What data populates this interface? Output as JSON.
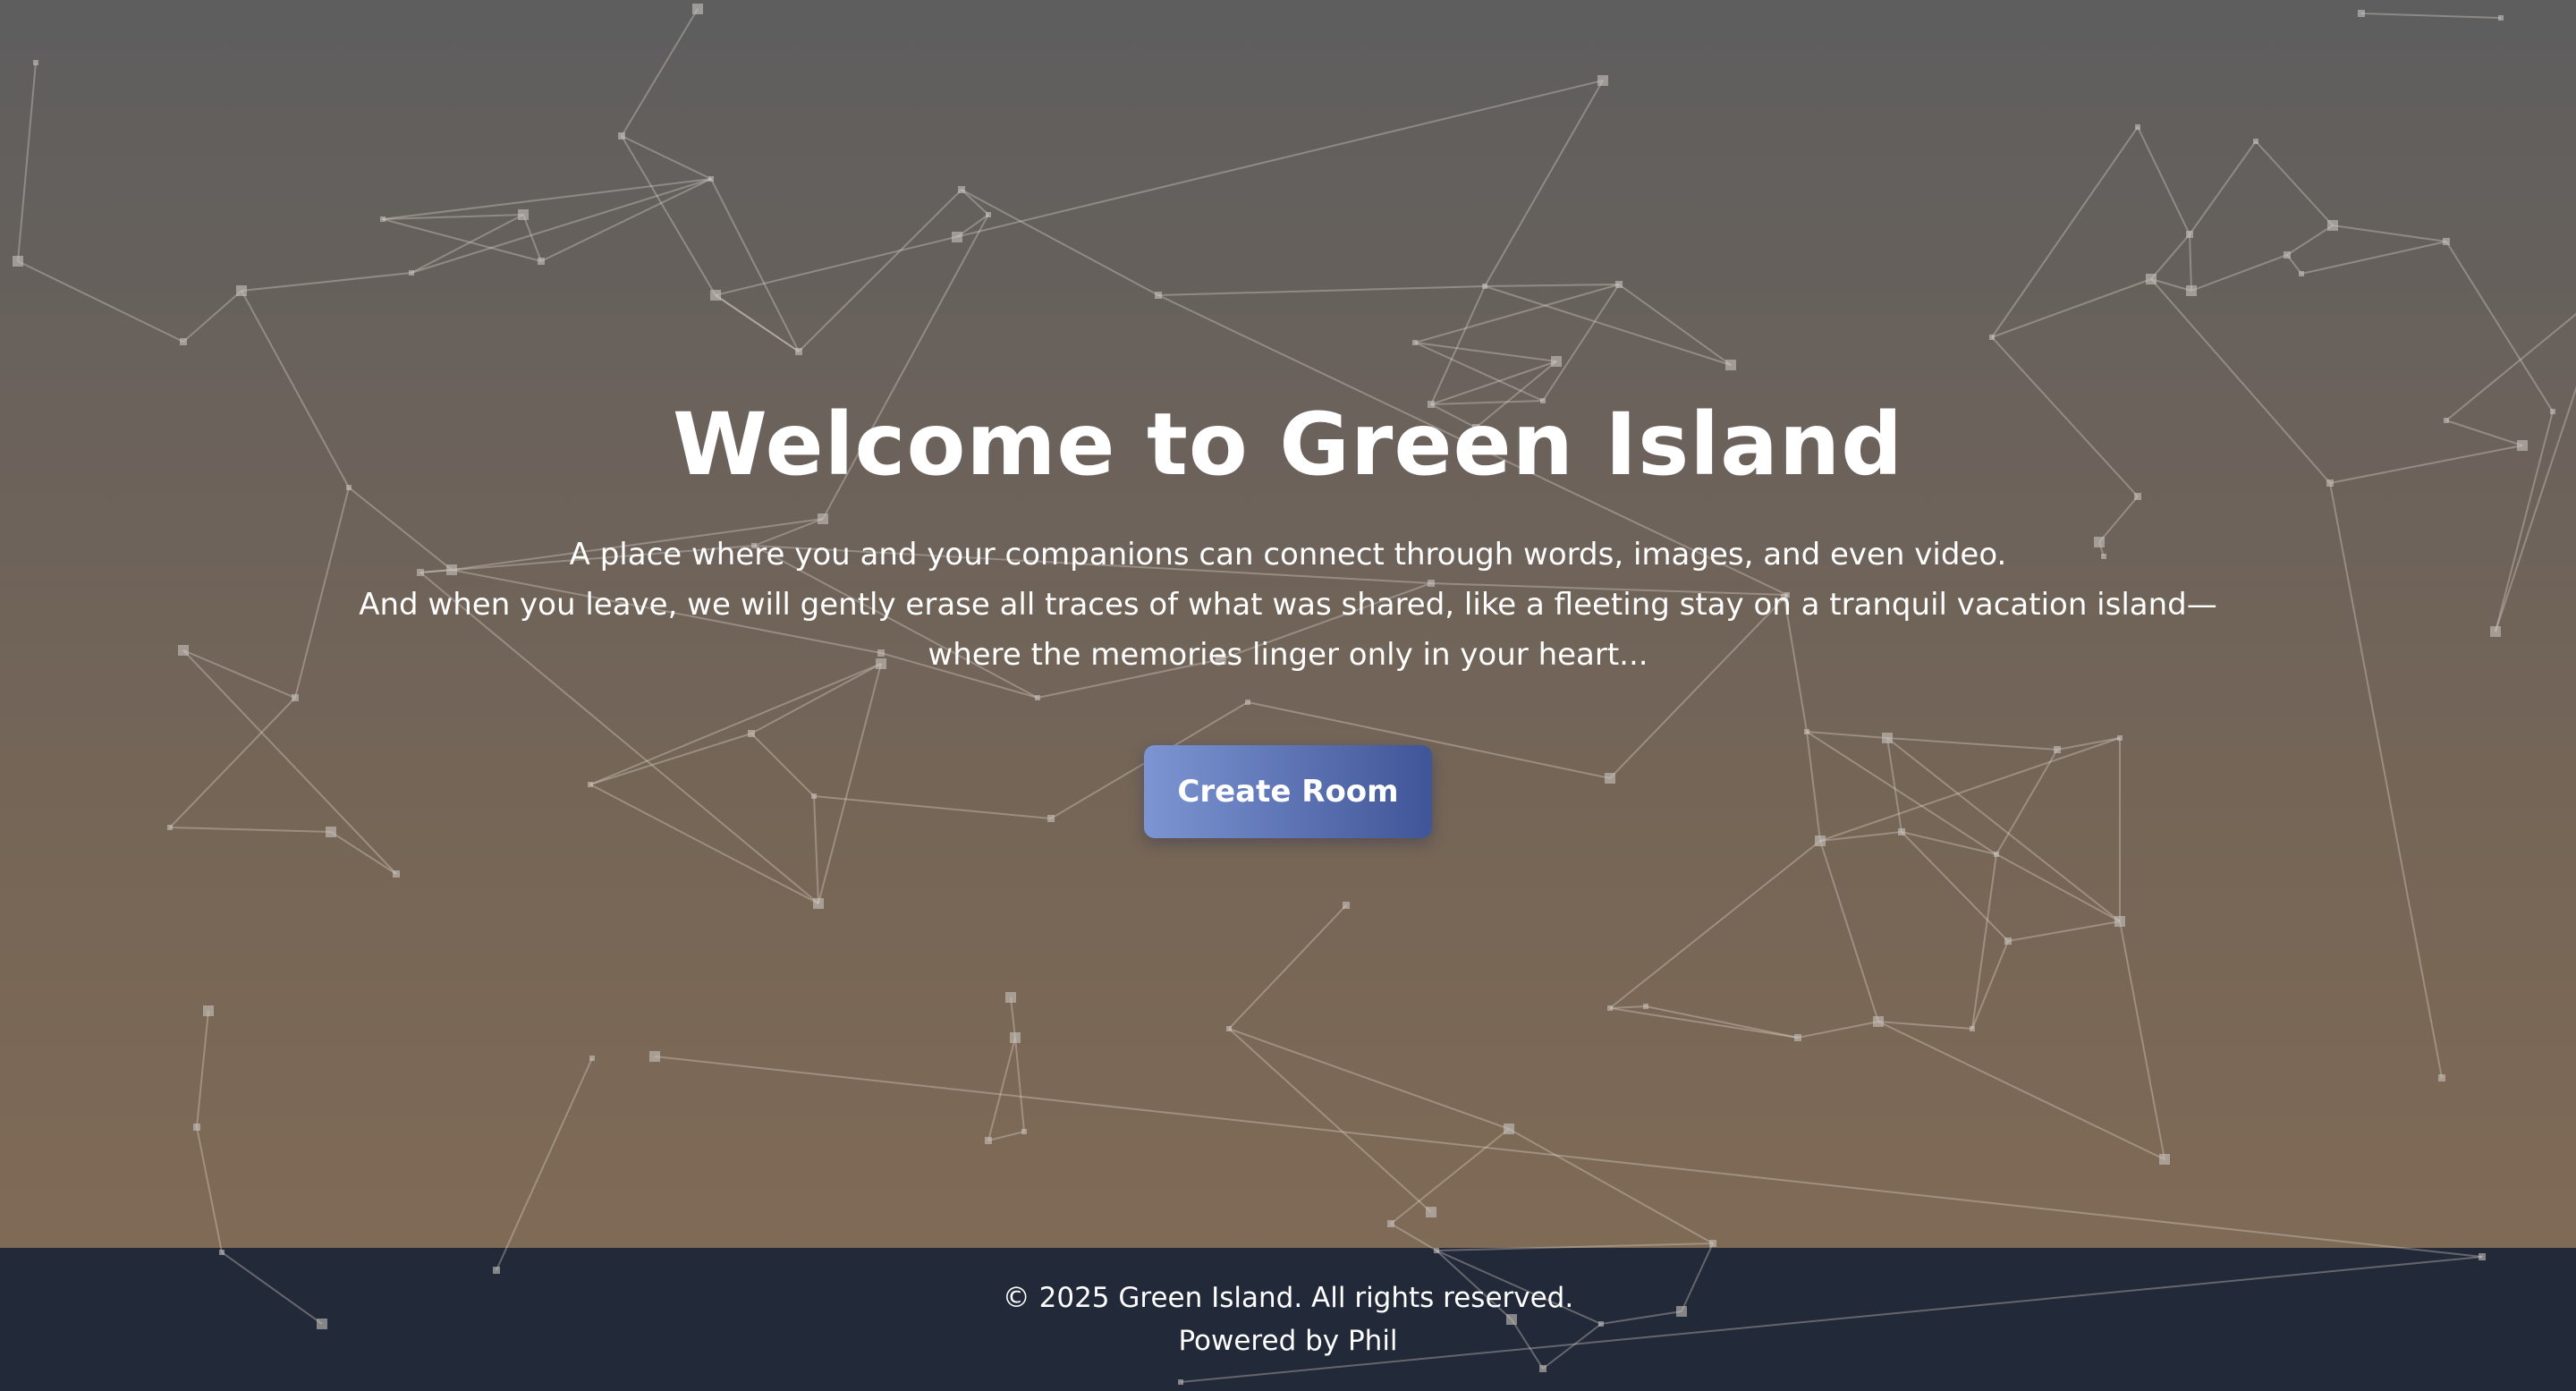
{
  "hero": {
    "title": "Welcome to Green Island",
    "subtitle_lines": [
      "A place where you and your companions can connect through words, images, and even video.",
      "And when you leave, we will gently erase all traces of what was shared, like a fleeting stay on a tranquil vacation island—",
      "where the memories linger only in your heart..."
    ],
    "create_room_label": "Create Room"
  },
  "footer": {
    "copyright": "© 2025 Green Island. All rights reserved.",
    "powered_by": "Powered by Phil"
  },
  "colors": {
    "hero_gradient_top": "#5e5e5e",
    "hero_gradient_bottom": "#7f6a56",
    "footer_background": "#222938",
    "button_gradient_start": "#7d95d3",
    "button_gradient_end": "#3f5597",
    "text": "#ffffff"
  }
}
